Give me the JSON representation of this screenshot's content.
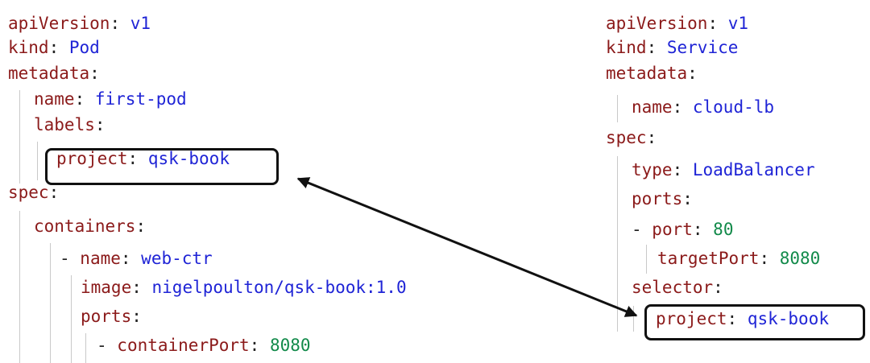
{
  "pod": {
    "apiVersion_key": "apiVersion",
    "apiVersion_value": "v1",
    "kind_key": "kind",
    "kind_value": "Pod",
    "metadata_key": "metadata",
    "name_key": "name",
    "name_value": "first-pod",
    "labels_key": "labels",
    "label_key": "project",
    "label_value": "qsk-book",
    "spec_key": "spec",
    "containers_key": "containers",
    "container_name_key": "name",
    "container_name_value": "web-ctr",
    "image_key": "image",
    "image_value": "nigelpoulton/qsk-book:1.0",
    "ports_key": "ports",
    "containerPort_key": "containerPort",
    "containerPort_value": "8080"
  },
  "service": {
    "apiVersion_key": "apiVersion",
    "apiVersion_value": "v1",
    "kind_key": "kind",
    "kind_value": "Service",
    "metadata_key": "metadata",
    "name_key": "name",
    "name_value": "cloud-lb",
    "spec_key": "spec",
    "type_key": "type",
    "type_value": "LoadBalancer",
    "ports_key": "ports",
    "port_key": "port",
    "port_value": "80",
    "targetPort_key": "targetPort",
    "targetPort_value": "8080",
    "selector_key": "selector",
    "selector_label_key": "project",
    "selector_label_value": "qsk-book"
  },
  "colors": {
    "key": "#8b1a1a",
    "string": "#1f24d6",
    "number": "#128a4a",
    "highlight_border": "#111111"
  }
}
